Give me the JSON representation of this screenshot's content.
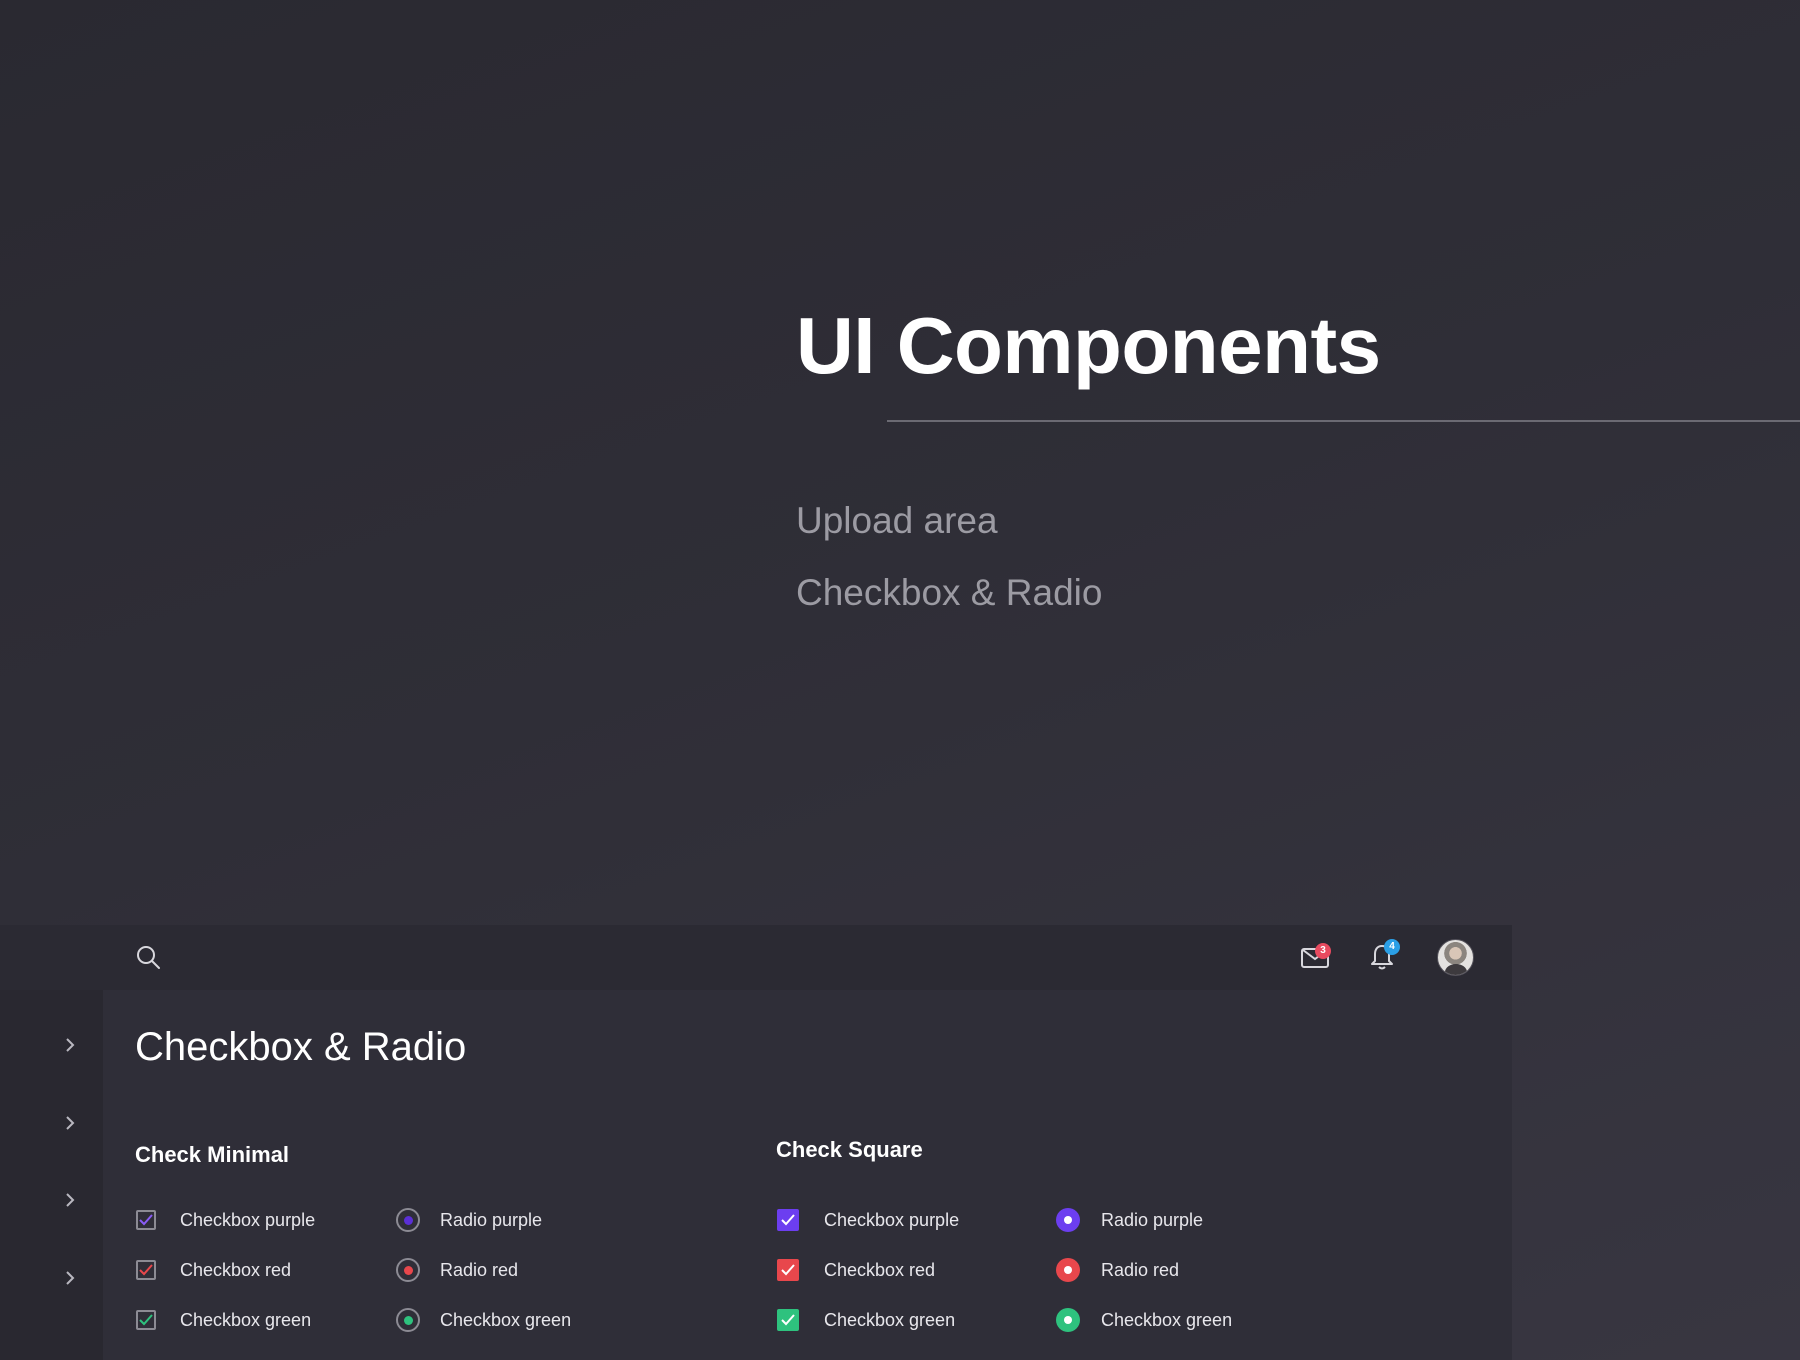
{
  "hero": {
    "title": "UI Components",
    "links": [
      "Upload area",
      "Checkbox & Radio"
    ]
  },
  "topbar": {
    "mail_badge": "3",
    "notification_badge": "4",
    "icons": [
      "search-icon",
      "mail-icon",
      "bell-icon"
    ]
  },
  "page": {
    "title": "Checkbox & Radio"
  },
  "sections": {
    "check_minimal": {
      "title": "Check Minimal",
      "checkboxes": [
        "Checkbox purple",
        "Checkbox  red",
        "Checkbox green"
      ],
      "radios": [
        "Radio purple",
        "Radio  red",
        "Checkbox green"
      ]
    },
    "check_square": {
      "title": "Check Square",
      "checkboxes": [
        "Checkbox purple",
        "Checkbox  red",
        "Checkbox green"
      ],
      "radios": [
        "Radio purple",
        "Radio  red",
        "Checkbox green"
      ]
    }
  },
  "colors": {
    "purple": "#6c3ef0",
    "red": "#e8474c",
    "green": "#2ec27e"
  }
}
